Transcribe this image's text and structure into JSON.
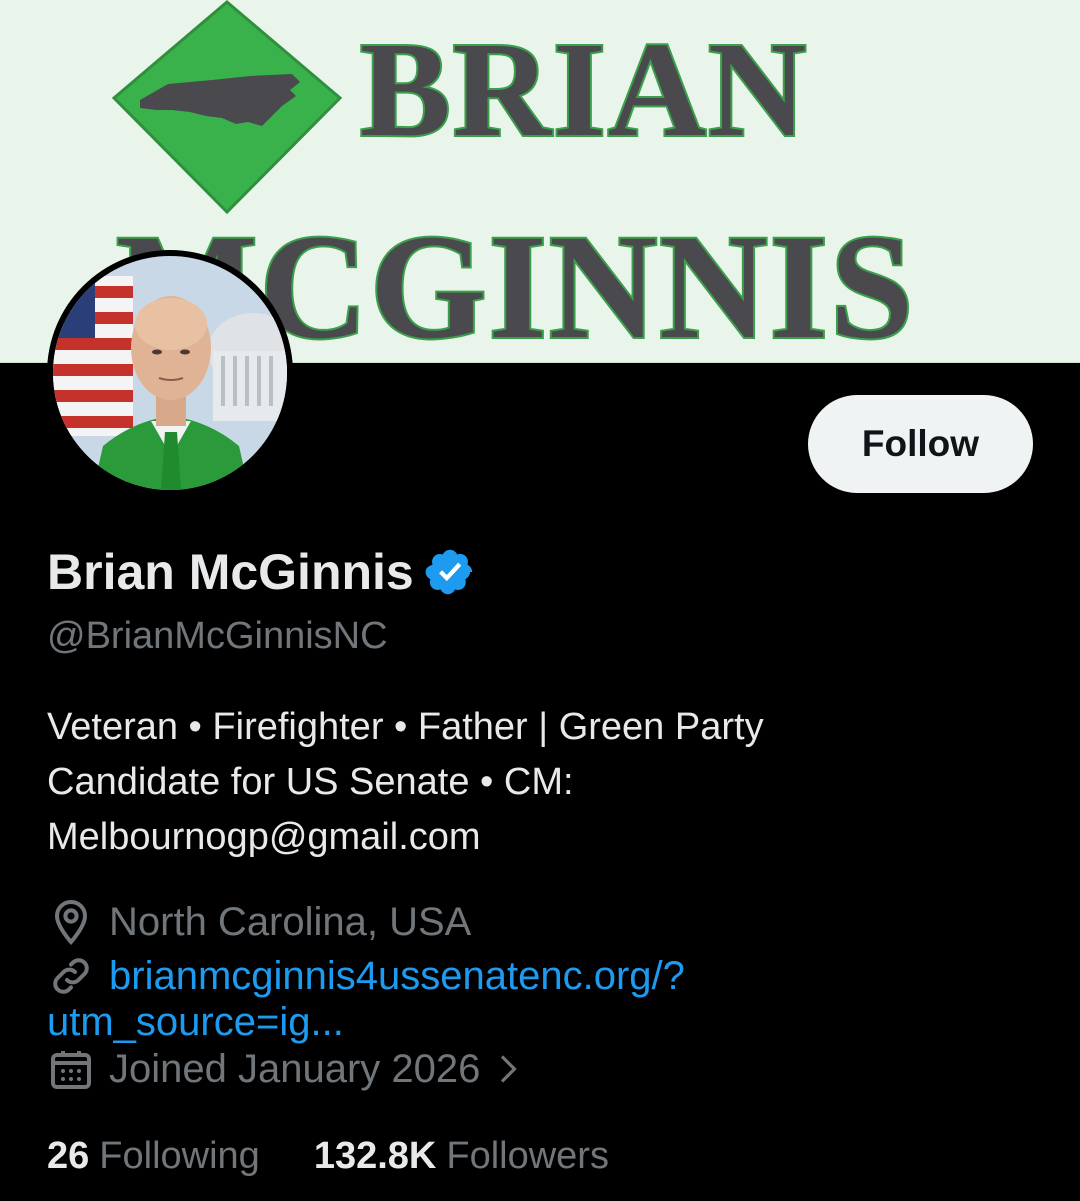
{
  "banner": {
    "line1": "BRIAN",
    "line2": "MCGINNIS"
  },
  "profile": {
    "display_name": "Brian McGinnis",
    "handle": "@BrianMcGinnisNC",
    "verified": true,
    "follow_label": "Follow",
    "bio_lines": [
      "Veteran • Firefighter • Father | Green Party",
      "Candidate for US Senate • CM:",
      "Melbournogp@gmail.com"
    ],
    "location": "North Carolina, USA",
    "link_line1": "brianmcginnis4ussenatenc.org/?",
    "link_line2": "utm_source=ig...",
    "joined": "Joined January 2026",
    "following_count": "26",
    "following_label": "Following",
    "followers_count": "132.8K",
    "followers_label": "Followers"
  },
  "icons": {
    "location": "location-pin-icon",
    "link": "link-icon",
    "calendar": "calendar-icon",
    "verified": "verified-badge-icon",
    "chevron": "chevron-right-icon"
  },
  "colors": {
    "background": "#000000",
    "banner_bg": "#e9f5ea",
    "banner_green": "#3aa04a",
    "link_blue": "#1d9bf0",
    "secondary_text": "#71767b",
    "verified_blue": "#1d9bf0"
  }
}
